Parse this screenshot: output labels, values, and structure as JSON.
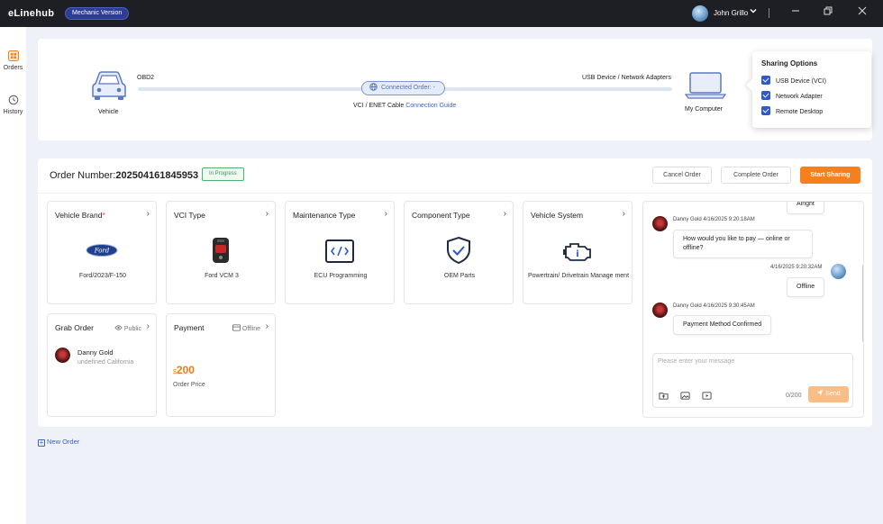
{
  "app": {
    "title": "eLinehub",
    "version_badge": "Mechanic Version"
  },
  "user": {
    "name": "John Grillo"
  },
  "window_controls": [
    "minimize-icon",
    "restore-icon",
    "close-icon"
  ],
  "nav": [
    {
      "label": "Orders",
      "icon": "orders-icon",
      "active": true
    },
    {
      "label": "History",
      "icon": "history-icon",
      "active": false
    }
  ],
  "connection": {
    "vehicle_label": "Vehicle",
    "obd_label": "OBD2",
    "status": "Connected Order: -",
    "vci_text": "VCI / ENET Cable",
    "guide_link": "Connection Guide",
    "usb_label": "USB Device / Network Adapters",
    "computer_label": "My Computer"
  },
  "sharing": {
    "title": "Sharing Options",
    "options": [
      {
        "label": "USB Device (VCI)",
        "checked": true
      },
      {
        "label": "Network Adapter",
        "checked": true
      },
      {
        "label": "Remote Desktop",
        "checked": true
      }
    ]
  },
  "order": {
    "number_label": "Order Number:",
    "number": "202504161845953",
    "status": "In Progress",
    "cancel_label": "Cancel Order",
    "complete_label": "Complete Order",
    "start_label": "Start Sharing"
  },
  "cards": {
    "vehicle_brand": {
      "title": "Vehicle Brand",
      "required_mark": "*",
      "value": "Ford/2023/F-150"
    },
    "vci_type": {
      "title": "VCI Type",
      "value": "Ford VCM 3"
    },
    "maintenance_type": {
      "title": "Maintenance Type",
      "value": "ECU Programming"
    },
    "component_type": {
      "title": "Component Type",
      "value": "OEM Parts"
    },
    "vehicle_system": {
      "title": "Vehicle System",
      "value": "Powertrain/ Drivetrain Manage ment"
    },
    "grab_order": {
      "title": "Grab Order",
      "tag": "Public",
      "name": "Danny Gold",
      "location": "undefined California"
    },
    "payment": {
      "title": "Payment",
      "tag": "Offline",
      "currency": "$",
      "amount": "200",
      "amount_label": "Order Price"
    }
  },
  "chat": {
    "messages": [
      {
        "text": "Alright",
        "side": "right"
      },
      {
        "meta": "Danny Gold 4/16/2025 9:20:18AM",
        "text": "How would you like to pay — online or offline?",
        "side": "left"
      },
      {
        "meta": "4/16/2025 9:20:32AM",
        "text": "Offline",
        "side": "right"
      },
      {
        "meta": "Danny Gold 4/16/2025 9:30:45AM",
        "text": "Payment Method Confirmed",
        "side": "left"
      }
    ],
    "input_placeholder": "Please enter your message",
    "char_count": "0/200",
    "send_label": "Send"
  },
  "new_order_label": "New Order",
  "colors": {
    "accent": "#f5801e",
    "link": "#3f63c7",
    "status_green": "#2f9c4d",
    "checkbox": "#2f58c9"
  }
}
